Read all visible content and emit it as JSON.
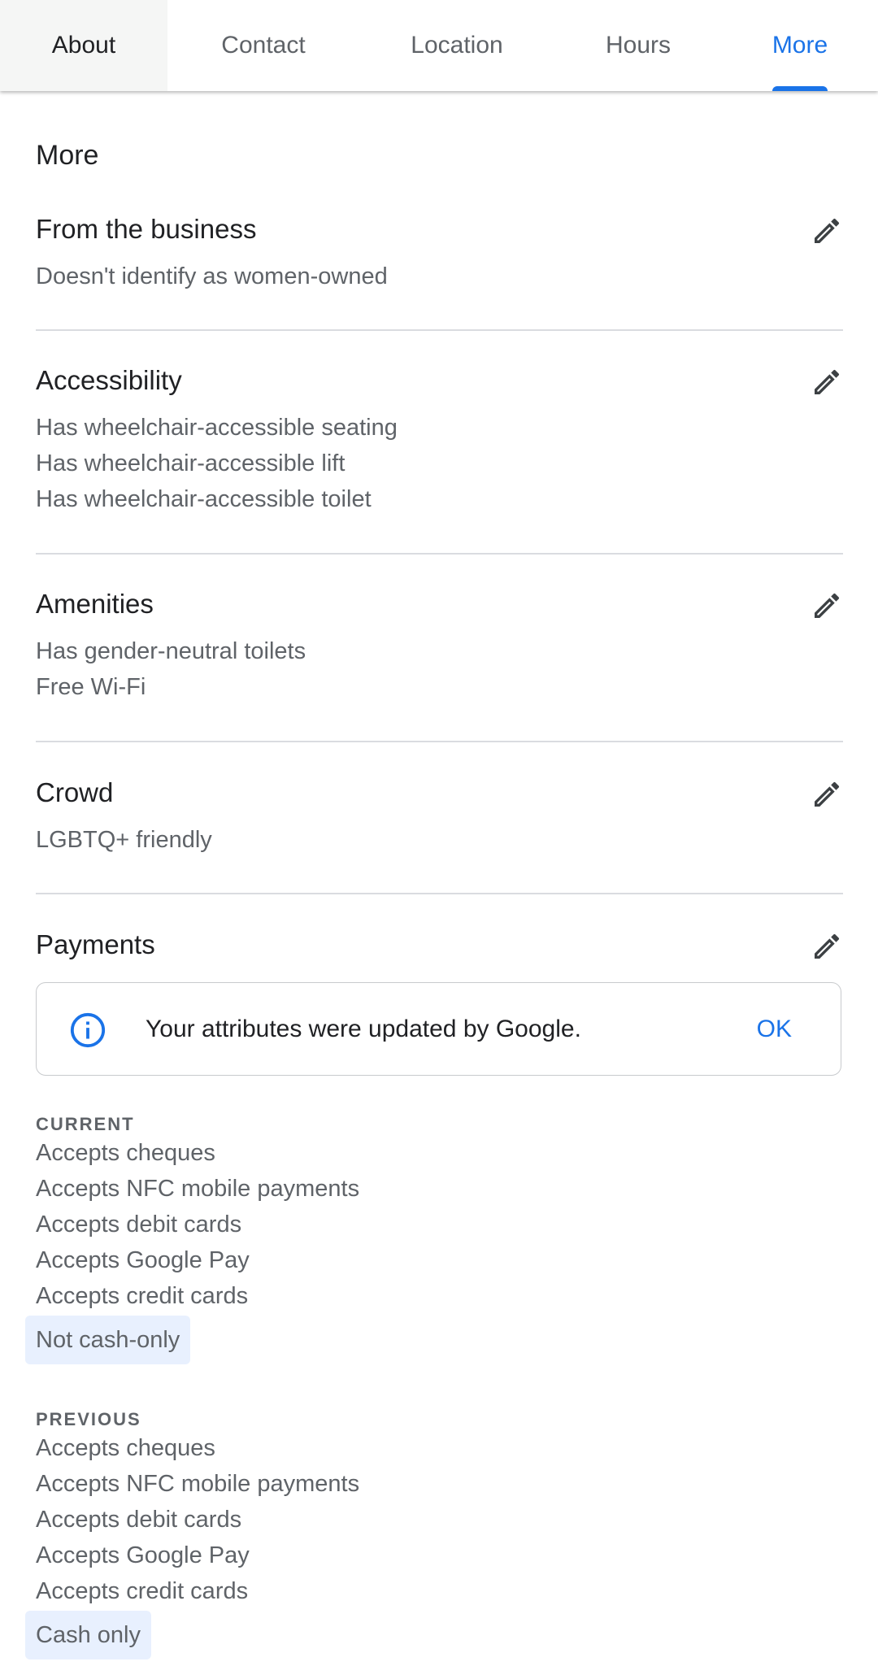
{
  "tabs": [
    {
      "label": "About"
    },
    {
      "label": "Contact"
    },
    {
      "label": "Location"
    },
    {
      "label": "Hours"
    },
    {
      "label": "More"
    }
  ],
  "page_title": "More",
  "sections": {
    "business": {
      "title": "From the business",
      "lines": [
        "Doesn't identify as women-owned"
      ]
    },
    "accessibility": {
      "title": "Accessibility",
      "lines": [
        "Has wheelchair-accessible seating",
        "Has wheelchair-accessible lift",
        "Has wheelchair-accessible toilet"
      ]
    },
    "amenities": {
      "title": "Amenities",
      "lines": [
        "Has gender-neutral toilets",
        "Free Wi-Fi"
      ]
    },
    "crowd": {
      "title": "Crowd",
      "lines": [
        "LGBTQ+ friendly"
      ]
    },
    "payments": {
      "title": "Payments",
      "notice": {
        "message": "Your attributes were updated by Google.",
        "ok_label": "OK"
      },
      "current": {
        "caption": "CURRENT",
        "lines": [
          "Accepts cheques",
          "Accepts NFC mobile payments",
          "Accepts debit cards",
          "Accepts Google Pay",
          "Accepts credit cards"
        ],
        "changed": "Not cash-only"
      },
      "previous": {
        "caption": "PREVIOUS",
        "lines": [
          "Accepts cheques",
          "Accepts NFC mobile payments",
          "Accepts debit cards",
          "Accepts Google Pay",
          "Accepts credit cards"
        ],
        "changed": "Cash only"
      }
    }
  },
  "colors": {
    "accent": "#1a73e8",
    "highlight": "#e8f0fe",
    "divider": "#dadce0"
  },
  "icons": {
    "edit": "pencil-icon",
    "info": "info-icon"
  }
}
